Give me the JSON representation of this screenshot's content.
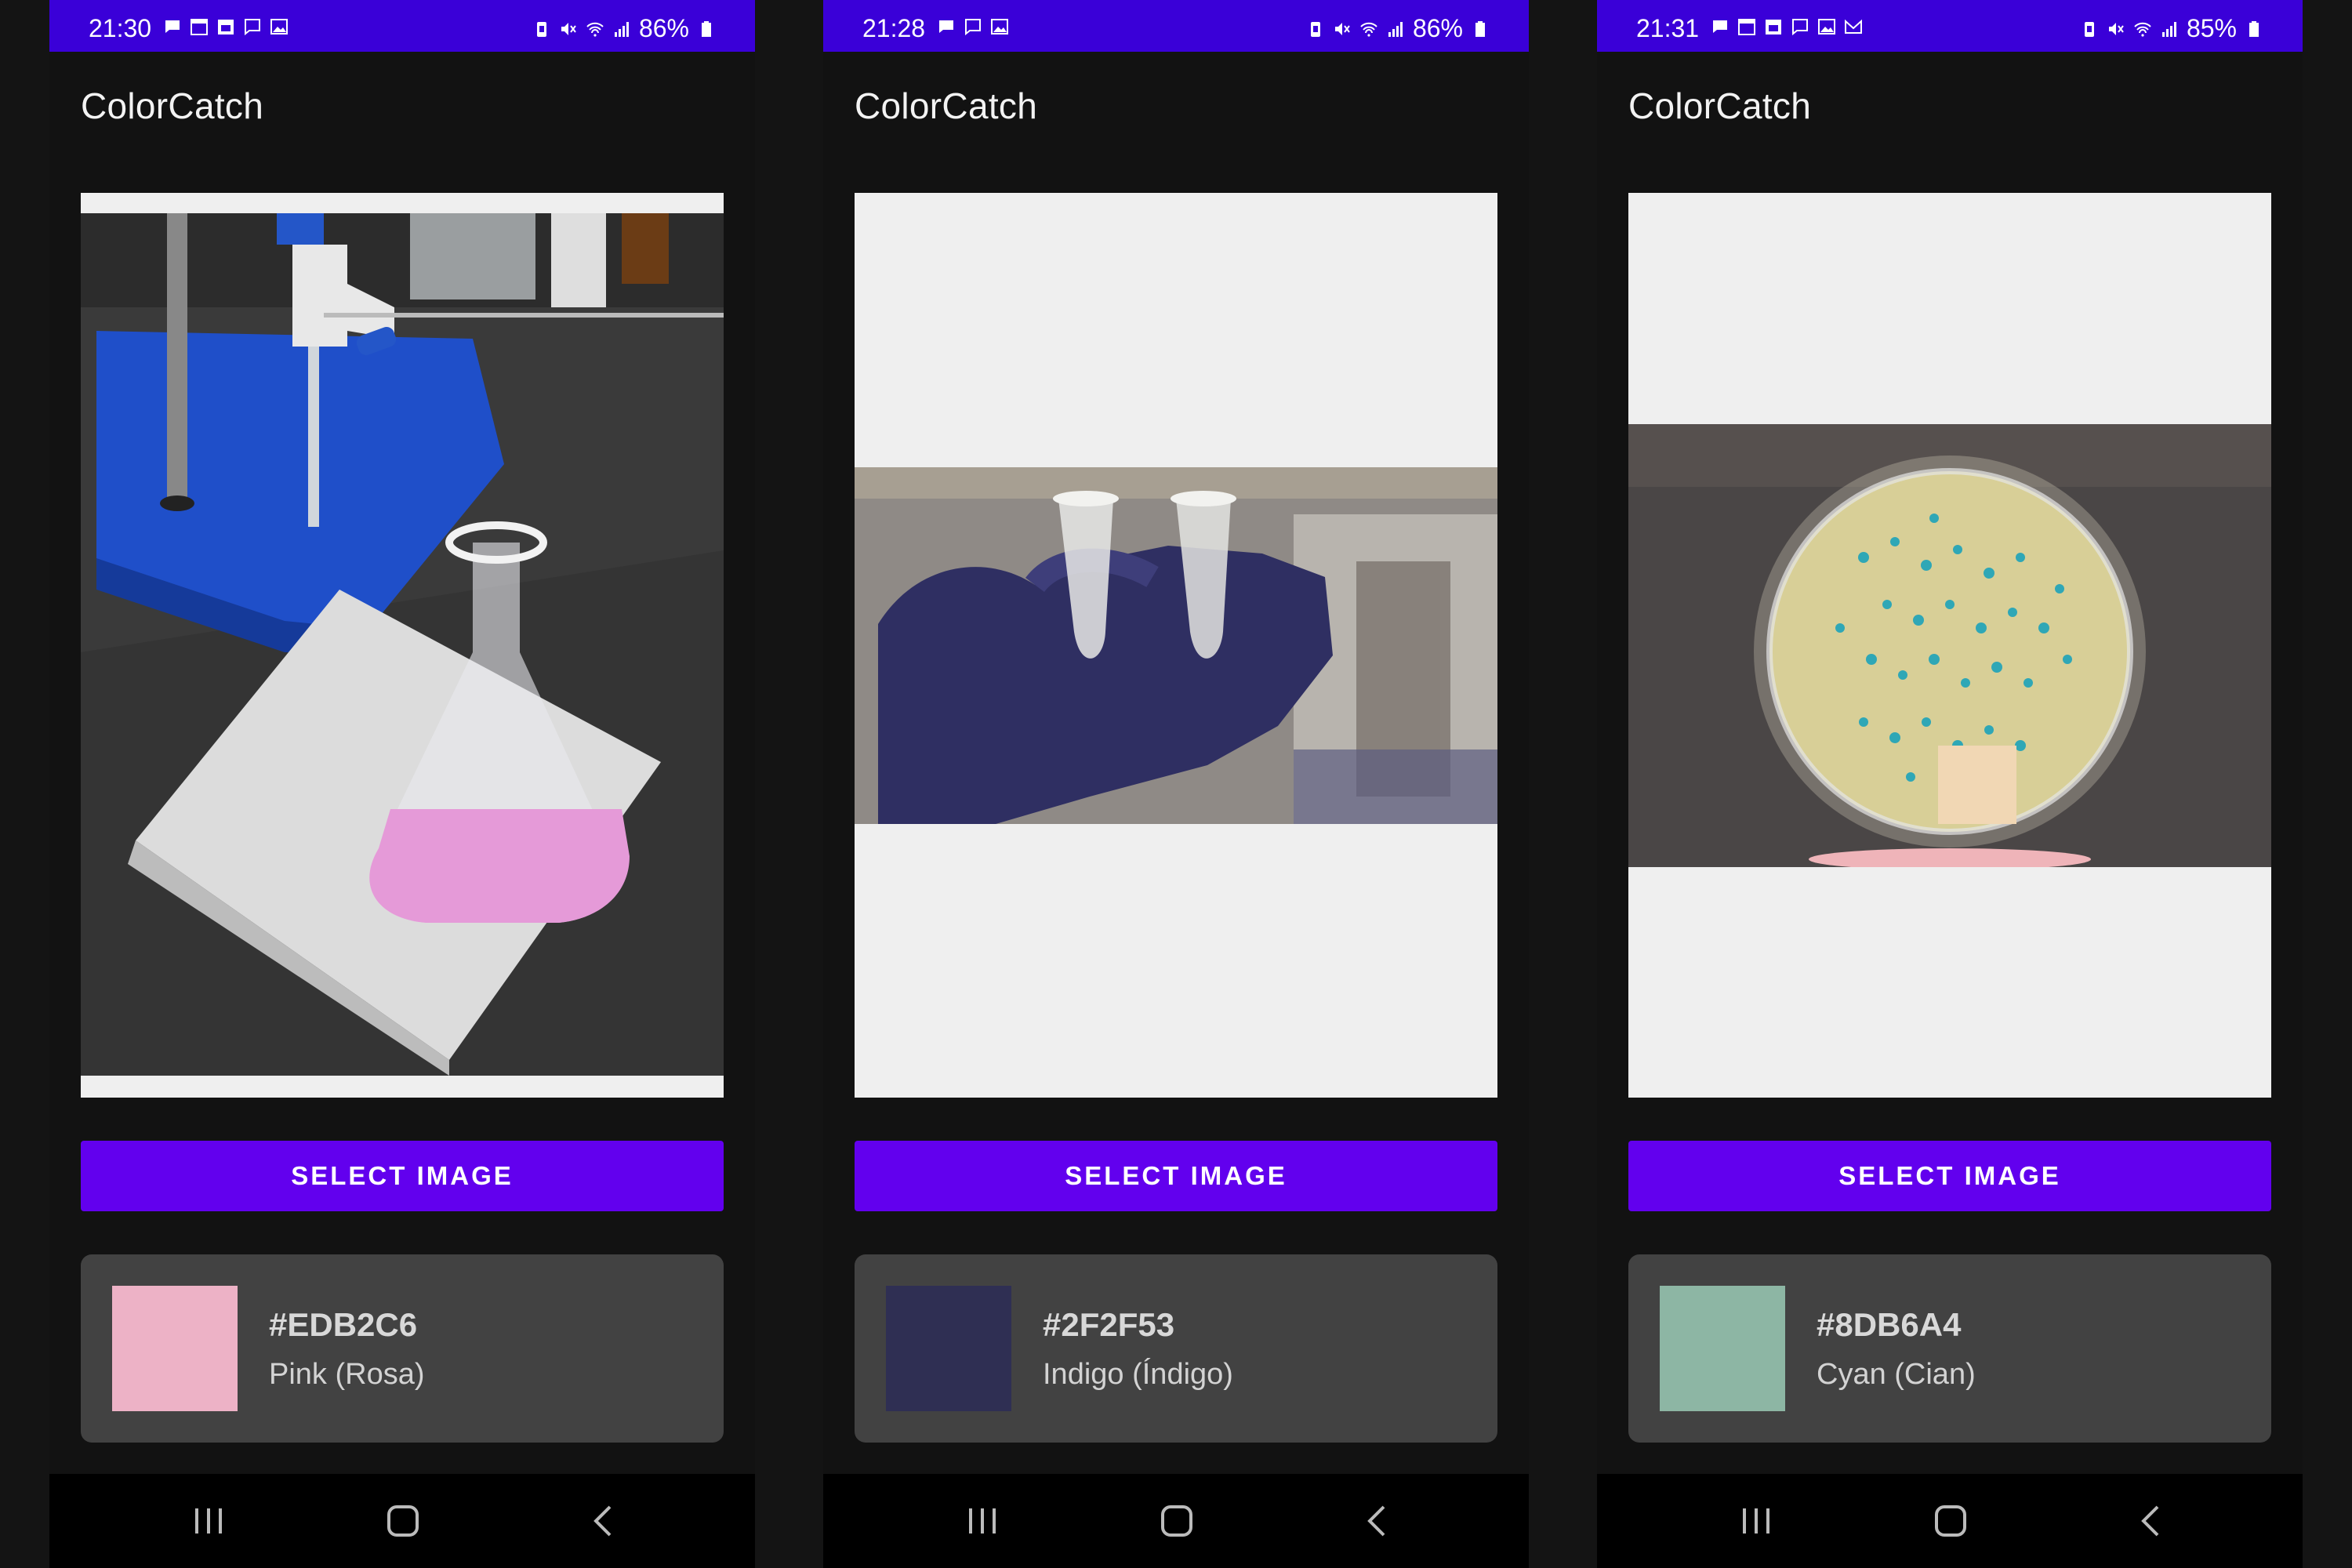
{
  "screens": [
    {
      "status": {
        "time": "21:30",
        "battery": "86%"
      },
      "app_title": "ColorCatch",
      "select_label": "SELECT IMAGE",
      "result": {
        "hex": "#EDB2C6",
        "name": "Pink (Rosa)",
        "swatch_color": "#EDB2C6"
      },
      "image_description": "Lab bench with a blue ring stand, burette and an Erlenmeyer flask of pink solution on a white napkin"
    },
    {
      "status": {
        "time": "21:28",
        "battery": "86%"
      },
      "app_title": "ColorCatch",
      "select_label": "SELECT IMAGE",
      "result": {
        "hex": "#2F2F53",
        "name": "Indigo (Índigo)",
        "swatch_color": "#2F2F53"
      },
      "image_description": "Indigo-gloved hand holding two small microcentrifuge tubes"
    },
    {
      "status": {
        "time": "21:31",
        "battery": "85%"
      },
      "app_title": "ColorCatch",
      "select_label": "SELECT IMAGE",
      "result": {
        "hex": "#8DB6A4",
        "name": "Cyan (Cian)",
        "swatch_color": "#8DB6A4"
      },
      "image_description": "Petri dish with blue/cyan bacterial colonies on a yellow agar plate"
    }
  ],
  "colors": {
    "status_bar": "#3A00D8",
    "button": "#6200EE",
    "card": "#424242",
    "background": "#121212"
  },
  "icons": [
    "chat-icon",
    "calendar-icon",
    "message-icon",
    "gallery-icon",
    "mail-icon",
    "battery-saver-icon",
    "mute-icon",
    "wifi-icon",
    "signal-icon",
    "battery-icon",
    "recents-icon",
    "home-icon",
    "back-icon"
  ]
}
